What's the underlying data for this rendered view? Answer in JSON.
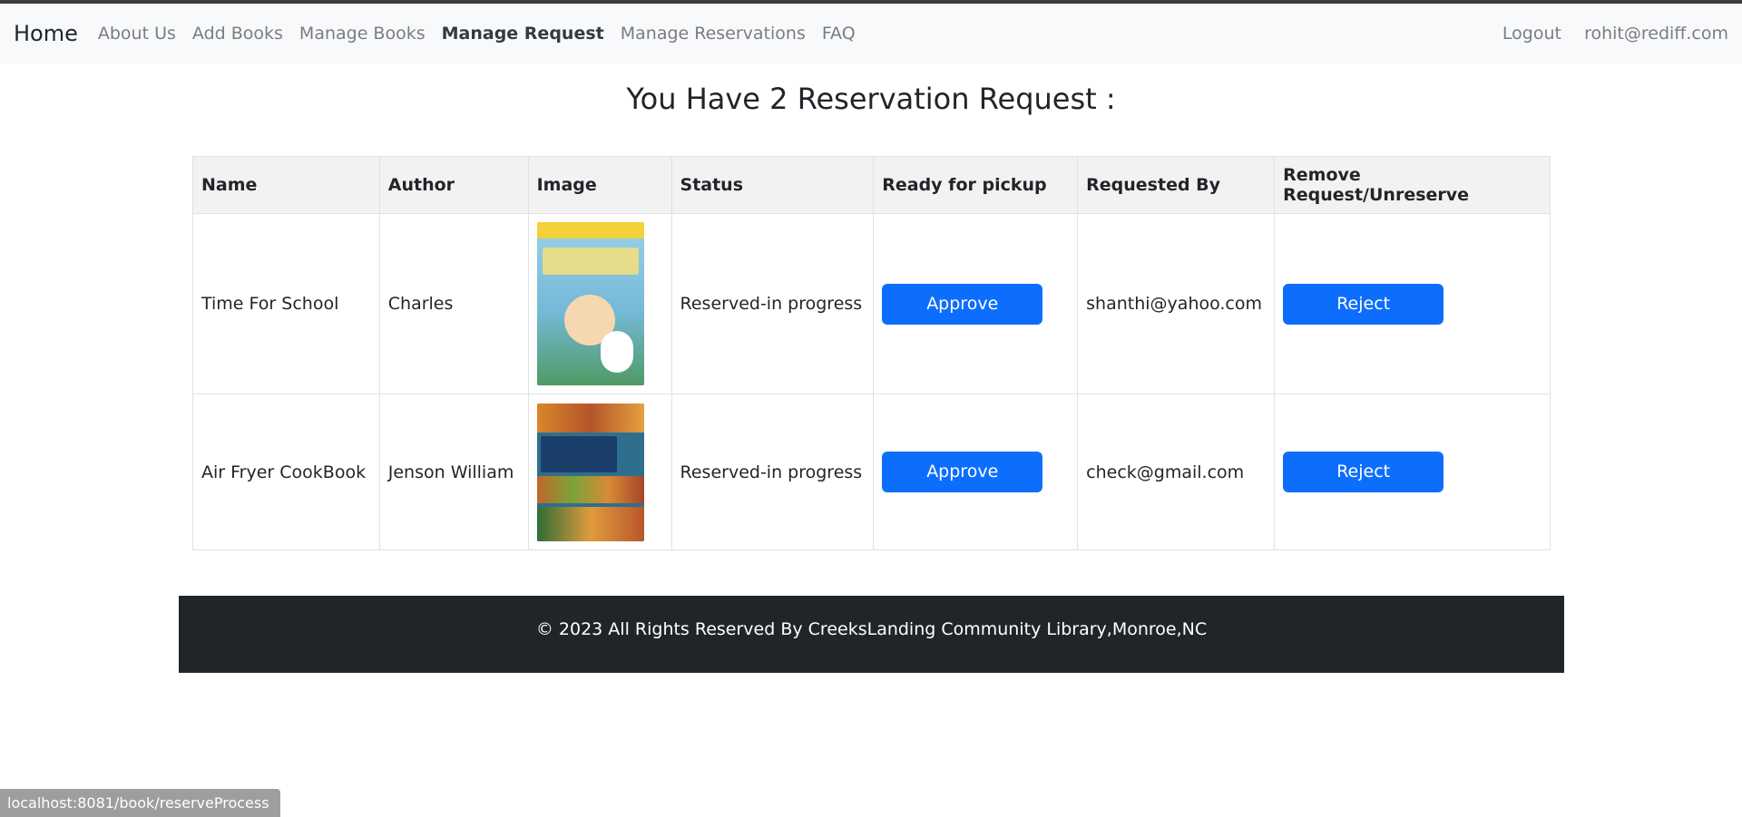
{
  "nav": {
    "brand": "Home",
    "links": [
      "About Us",
      "Add Books",
      "Manage Books",
      "Manage Request",
      "Manage Reservations",
      "FAQ"
    ],
    "active": "Manage Request",
    "right": [
      "Logout",
      "rohit@rediff.com"
    ]
  },
  "heading": "You Have 2 Reservation Request :",
  "table": {
    "headers": [
      "Name",
      "Author",
      "Image",
      "Status",
      "Ready for pickup",
      "Requested By",
      "Remove Request/Unreserve"
    ],
    "rows": [
      {
        "name": "Time For School",
        "author": "Charles",
        "image": "book-cover-charlie-brown",
        "status": "Reserved-in progress",
        "approve": "Approve",
        "requested_by": "shanthi@yahoo.com",
        "reject": "Reject"
      },
      {
        "name": "Air Fryer CookBook",
        "author": "Jenson William",
        "image": "book-cover-air-fryer",
        "status": "Reserved-in progress",
        "approve": "Approve",
        "requested_by": "check@gmail.com",
        "reject": "Reject"
      }
    ]
  },
  "footer": "© 2023 All Rights Reserved By CreeksLanding Community Library,Monroe,NC",
  "statusbar": "localhost:8081/book/reserveProcess",
  "colors": {
    "accent": "#0d6efd",
    "footer_bg": "#212529",
    "navbar_bg": "#f8f9fa"
  }
}
